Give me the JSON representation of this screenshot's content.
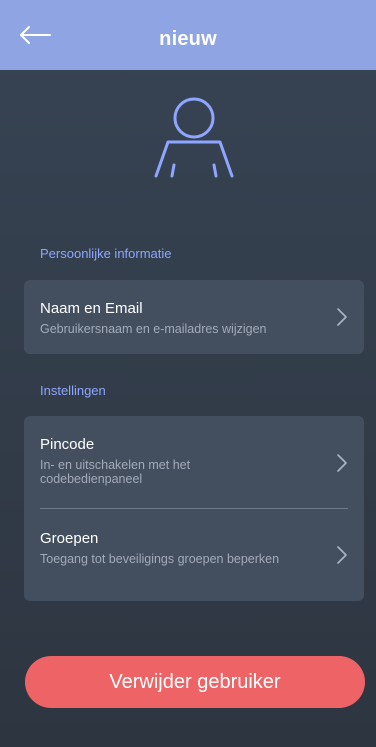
{
  "header": {
    "title": "nieuw",
    "back_icon": "arrow-left-icon",
    "background": "#8fa5e3"
  },
  "avatar": {
    "icon": "user-icon",
    "color": "#8ea6ff"
  },
  "sections": [
    {
      "title": "Persoonlijke informatie",
      "items": [
        {
          "title": "Naam en Email",
          "subtitle": "Gebruikersnaam en e-mailadres wijzigen",
          "icon": "chevron-right-icon"
        }
      ]
    },
    {
      "title": "Instellingen",
      "items": [
        {
          "title": "Pincode",
          "subtitle": "In- en uitschakelen met het codebedienpaneel",
          "icon": "chevron-right-icon"
        },
        {
          "title": "Groepen",
          "subtitle": "Toegang tot beveiligings groepen beperken",
          "icon": "chevron-right-icon"
        }
      ]
    }
  ],
  "delete_button": {
    "label": "Verwijder gebruiker",
    "color": "#ee6466"
  }
}
